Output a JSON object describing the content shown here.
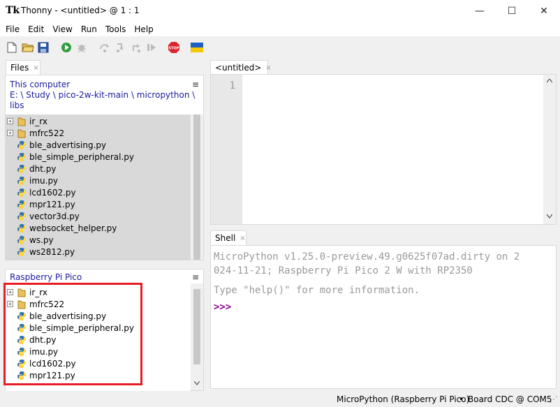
{
  "window": {
    "title": "Thonny  -  <untitled>  @  1 : 1",
    "app_icon": "Tk",
    "minimize": "—",
    "maximize": "☐",
    "close": "✕"
  },
  "menu": [
    "File",
    "Edit",
    "View",
    "Run",
    "Tools",
    "Help"
  ],
  "toolbar": {
    "icons": [
      "new-file-icon",
      "open-folder-icon",
      "save-icon",
      "run-icon",
      "debug-icon",
      "step-over-icon",
      "step-into-icon",
      "step-out-icon",
      "resume-icon",
      "stop-icon",
      "ukraine-flag-icon"
    ],
    "stop_label": "STOP"
  },
  "files_tab": {
    "label": "Files",
    "close": "×"
  },
  "local": {
    "title": "This computer",
    "path": [
      "E: \\ Study \\ pico-2w-kit-main \\ micropython \\",
      "libs"
    ],
    "items": [
      {
        "name": "ir_rx",
        "type": "folder"
      },
      {
        "name": "mfrc522",
        "type": "folder"
      },
      {
        "name": "ble_advertising.py",
        "type": "py"
      },
      {
        "name": "ble_simple_peripheral.py",
        "type": "py"
      },
      {
        "name": "dht.py",
        "type": "py"
      },
      {
        "name": "imu.py",
        "type": "py"
      },
      {
        "name": "lcd1602.py",
        "type": "py"
      },
      {
        "name": "mpr121.py",
        "type": "py"
      },
      {
        "name": "vector3d.py",
        "type": "py"
      },
      {
        "name": "websocket_helper.py",
        "type": "py"
      },
      {
        "name": "ws.py",
        "type": "py"
      },
      {
        "name": "ws2812.py",
        "type": "py"
      }
    ]
  },
  "device": {
    "title": "Raspberry Pi Pico",
    "items": [
      {
        "name": "ir_rx",
        "type": "folder"
      },
      {
        "name": "mfrc522",
        "type": "folder"
      },
      {
        "name": "ble_advertising.py",
        "type": "py"
      },
      {
        "name": "ble_simple_peripheral.py",
        "type": "py"
      },
      {
        "name": "dht.py",
        "type": "py"
      },
      {
        "name": "imu.py",
        "type": "py"
      },
      {
        "name": "lcd1602.py",
        "type": "py"
      },
      {
        "name": "mpr121.py",
        "type": "py"
      }
    ]
  },
  "editor_tab": {
    "label": "<untitled>",
    "close": "×"
  },
  "editor": {
    "line_numbers": [
      "1"
    ]
  },
  "shell_tab": {
    "label": "Shell",
    "close": "×"
  },
  "shell": {
    "lines": [
      "MicroPython v1.25.0-preview.49.g0625f07ad.dirty on 2",
      "024-11-21; Raspberry Pi Pico 2 W with RP2350"
    ],
    "help": "Type \"help()\" for more information.",
    "prompt": ">>>"
  },
  "status": {
    "interpreter": "MicroPython (Raspberry Pi Pico)",
    "separator": "•",
    "port": "Board CDC @ COM5",
    "grip": "⋰"
  },
  "colors": {
    "highlight_box": "#e81c24",
    "folder": "#e8c15a",
    "python_blue": "#3572a5",
    "python_yellow": "#ffd43b",
    "prompt": "#8b008b",
    "path": "#1a1a9e"
  }
}
